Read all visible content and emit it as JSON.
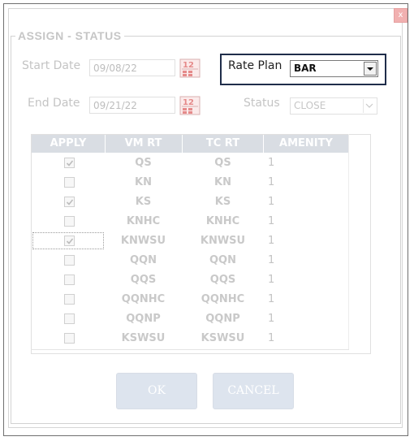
{
  "dialog": {
    "title": "ASSIGN - STATUS",
    "close_label": "x"
  },
  "form": {
    "start_date_label": "Start Date",
    "start_date_value": "09/08/22",
    "end_date_label": "End Date",
    "end_date_value": "09/21/22",
    "rate_plan_label": "Rate Plan",
    "rate_plan_value": "BAR",
    "status_label": "Status",
    "status_value": "CLOSE",
    "calendar_icon": "calendar-icon"
  },
  "table": {
    "columns": [
      "APPLY",
      "VM RT",
      "TC RT",
      "AMENITY"
    ],
    "rows": [
      {
        "apply": true,
        "vm_rt": "QS",
        "tc_rt": "QS",
        "amenity": "1"
      },
      {
        "apply": false,
        "vm_rt": "KN",
        "tc_rt": "KN",
        "amenity": "1"
      },
      {
        "apply": true,
        "vm_rt": "KS",
        "tc_rt": "KS",
        "amenity": "1"
      },
      {
        "apply": false,
        "vm_rt": "KNHC",
        "tc_rt": "KNHC",
        "amenity": "1"
      },
      {
        "apply": true,
        "vm_rt": "KNWSU",
        "tc_rt": "KNWSU",
        "amenity": "1"
      },
      {
        "apply": false,
        "vm_rt": "QQN",
        "tc_rt": "QQN",
        "amenity": "1"
      },
      {
        "apply": false,
        "vm_rt": "QQS",
        "tc_rt": "QQS",
        "amenity": "1"
      },
      {
        "apply": false,
        "vm_rt": "QQNHC",
        "tc_rt": "QQNHC",
        "amenity": "1"
      },
      {
        "apply": false,
        "vm_rt": "QQNP",
        "tc_rt": "QQNP",
        "amenity": "1"
      },
      {
        "apply": false,
        "vm_rt": "KSWSU",
        "tc_rt": "KSWSU",
        "amenity": "1"
      }
    ]
  },
  "buttons": {
    "ok_label": "OK",
    "cancel_label": "CANCEL"
  },
  "colors": {
    "rate_plan_border": "#1f2d4a",
    "header_bg": "#d9dde3",
    "button_bg": "#dde4ee",
    "disabled_text": "#c4c4c4"
  }
}
